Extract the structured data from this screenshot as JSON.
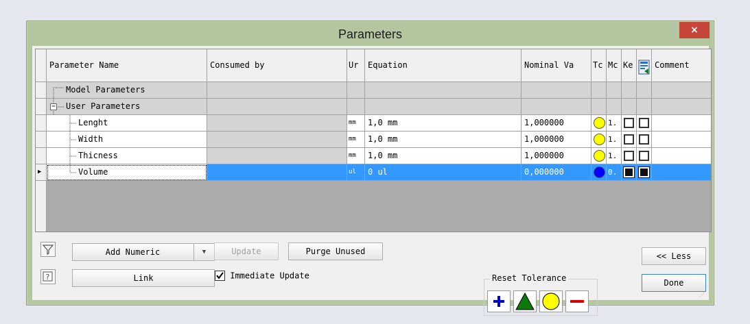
{
  "window": {
    "title": "Parameters",
    "close_glyph": "×"
  },
  "grid": {
    "columns": [
      "Parameter Name",
      "Consumed by",
      "Ur",
      "Equation",
      "Nominal Va",
      "Tc",
      "Mc",
      "Ke",
      "",
      "Comment"
    ],
    "export_column_icon": "export-parameters-icon",
    "groups": [
      {
        "name": "Model Parameters",
        "expander": ""
      },
      {
        "name": "User Parameters",
        "expander": "−"
      }
    ],
    "rows": [
      {
        "name": "Lenght",
        "consumed_by": "",
        "unit": "mm",
        "equation": "1,0 mm",
        "nominal": "1,000000",
        "tol_color": "#ffff00",
        "model_value": "1.",
        "key": false,
        "export": false,
        "comment": "",
        "selected": false
      },
      {
        "name": "Width",
        "consumed_by": "",
        "unit": "mm",
        "equation": "1,0 mm",
        "nominal": "1,000000",
        "tol_color": "#ffff00",
        "model_value": "1.",
        "key": false,
        "export": false,
        "comment": "",
        "selected": false
      },
      {
        "name": "Thicness",
        "consumed_by": "",
        "unit": "mm",
        "equation": "1,0 mm",
        "nominal": "1,000000",
        "tol_color": "#ffff00",
        "model_value": "1.",
        "key": false,
        "export": false,
        "comment": "",
        "selected": false
      },
      {
        "name": "Volume",
        "consumed_by": "",
        "unit": "ul",
        "equation": "0 ul",
        "nominal": "0,000000",
        "tol_color": "#0000ff",
        "model_value": "0.",
        "key": false,
        "export": false,
        "comment": "",
        "selected": true
      }
    ],
    "current_row_marker": "▶"
  },
  "buttons": {
    "add_numeric": "Add Numeric",
    "add_numeric_arrow": "▼",
    "update": "Update",
    "purge_unused": "Purge Unused",
    "link": "Link",
    "immediate_update": "Immediate Update",
    "immediate_update_checked": true,
    "less": "<< Less",
    "done": "Done"
  },
  "reset_tolerance": {
    "label": "Reset Tolerance",
    "options": [
      "upper-tolerance-icon",
      "median-tolerance-icon",
      "nominal-tolerance-icon",
      "lower-tolerance-icon"
    ],
    "colors": {
      "plus": "#0000cc",
      "triangle": "#0b7a0b",
      "circle": "#ffff00",
      "minus": "#dd0000"
    }
  },
  "icons": {
    "filter": "filter-icon",
    "help": "help-icon"
  }
}
